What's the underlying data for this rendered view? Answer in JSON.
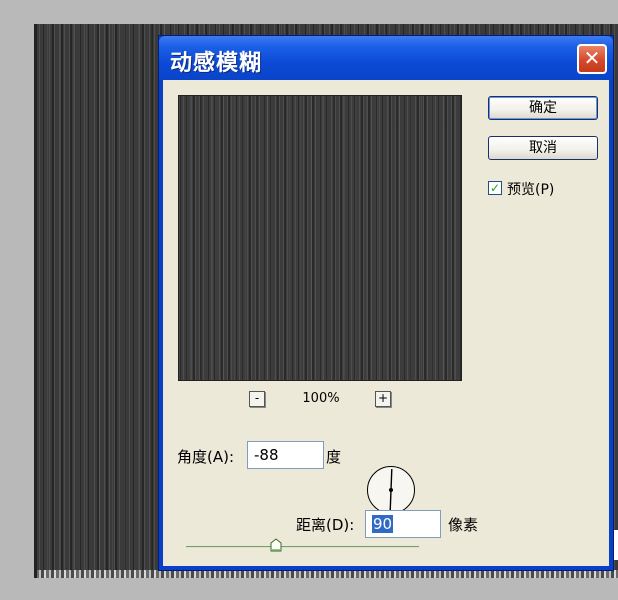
{
  "dialog": {
    "title": "动感模糊",
    "close_symbol": "✕",
    "ok_label": "确定",
    "cancel_label": "取消",
    "preview_checkbox": {
      "label": "预览(P)",
      "checked": true
    },
    "zoom": {
      "minus": "-",
      "plus": "+",
      "level": "100%"
    },
    "angle": {
      "label": "角度(A):",
      "value": "-88",
      "unit": "度"
    },
    "distance": {
      "label": "距离(D):",
      "value": "90",
      "unit": "像素"
    }
  },
  "colors": {
    "titlebar": "#0c4bd6",
    "dialog_body": "#ece9d8",
    "close_button": "#d5492a",
    "selection": "#316ac5"
  },
  "icons": [
    "close-icon",
    "check-icon",
    "angle-dial-icon",
    "slider-thumb-icon"
  ]
}
